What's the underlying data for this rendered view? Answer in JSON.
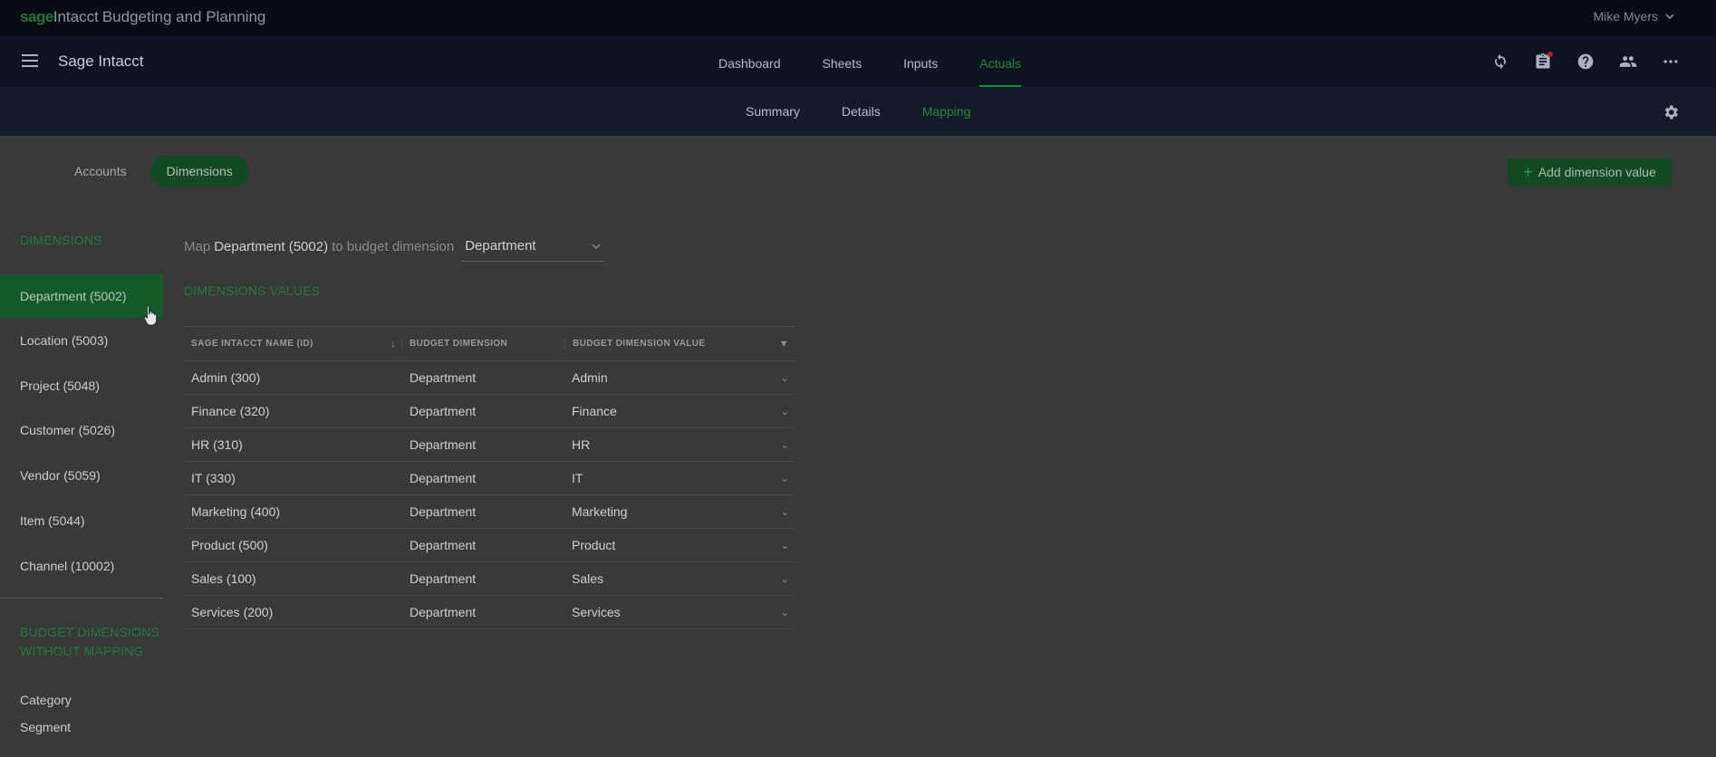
{
  "topbar": {
    "brand_sage": "sage",
    "brand_intacct": "Intacct",
    "brand_product": "Budgeting and Planning",
    "user_name": "Mike Myers"
  },
  "navbar": {
    "app_title": "Sage Intacct",
    "tabs": [
      {
        "label": "Dashboard"
      },
      {
        "label": "Sheets"
      },
      {
        "label": "Inputs"
      },
      {
        "label": "Actuals",
        "active": true
      }
    ],
    "icons": [
      "refresh-icon",
      "clipboard-icon",
      "help-icon",
      "people-icon",
      "more-icon"
    ]
  },
  "subnav": {
    "tabs": [
      {
        "label": "Summary"
      },
      {
        "label": "Details"
      },
      {
        "label": "Mapping",
        "active": true
      }
    ]
  },
  "toggle": {
    "accounts": "Accounts",
    "dimensions": "Dimensions"
  },
  "add_button": "Add dimension value",
  "sidebar": {
    "heading": "DIMENSIONS",
    "items": [
      {
        "label": "Department (5002)",
        "active": true
      },
      {
        "label": "Location (5003)"
      },
      {
        "label": "Project (5048)"
      },
      {
        "label": "Customer (5026)"
      },
      {
        "label": "Vendor (5059)"
      },
      {
        "label": "Item (5044)"
      },
      {
        "label": "Channel (10002)"
      }
    ],
    "unmapped_heading_line1": "BUDGET DIMENSIONS",
    "unmapped_heading_line2": "WITHOUT MAPPING",
    "unmapped": [
      "Category",
      "Segment"
    ]
  },
  "mapping": {
    "prefix": "Map",
    "source": "Department (5002)",
    "middle": "to budget dimension",
    "selected": "Department"
  },
  "section_title": "DIMENSIONS VALUES",
  "grid": {
    "headers": [
      "SAGE INTACCT NAME (ID)",
      "BUDGET DIMENSION",
      "BUDGET DIMENSION VALUE"
    ],
    "rows": [
      {
        "name": "Admin (300)",
        "dimension": "Department",
        "value": "Admin"
      },
      {
        "name": "Finance (320)",
        "dimension": "Department",
        "value": "Finance"
      },
      {
        "name": "HR (310)",
        "dimension": "Department",
        "value": "HR"
      },
      {
        "name": "IT (330)",
        "dimension": "Department",
        "value": "IT"
      },
      {
        "name": "Marketing (400)",
        "dimension": "Department",
        "value": "Marketing"
      },
      {
        "name": "Product (500)",
        "dimension": "Department",
        "value": "Product"
      },
      {
        "name": "Sales (100)",
        "dimension": "Department",
        "value": "Sales"
      },
      {
        "name": "Services (200)",
        "dimension": "Department",
        "value": "Services"
      }
    ]
  }
}
